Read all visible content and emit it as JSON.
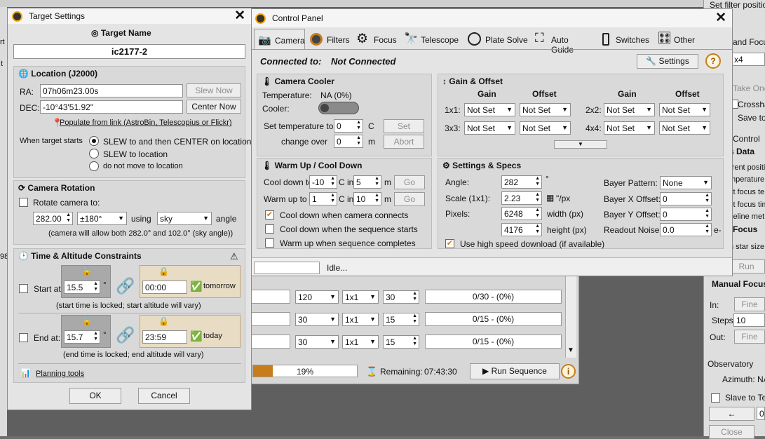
{
  "target_settings": {
    "title": "Target Settings",
    "target_name_label": "Target Name",
    "target_name": "ic2177-2",
    "location_label": "Location (J2000)",
    "ra_label": "RA:",
    "ra_value": "07h06m23.00s",
    "dec_label": "DEC:",
    "dec_value": "-10°43'51.92\"",
    "slew_now": "Slew Now",
    "center_now": "Center Now",
    "populate_link": "Populate from link (AstroBin, Telescopius or Flickr)",
    "when_target_starts": "When target starts",
    "radio_slew_center": "SLEW to and then CENTER on location",
    "radio_slew": "SLEW to location",
    "radio_no_move": "do not move to location",
    "camera_rotation_label": "Camera Rotation",
    "rotate_camera_label": "Rotate camera to:",
    "rotation_value": "282.00",
    "rotation_tolerance": "±180°",
    "using_label": "using",
    "rotation_ref": "sky",
    "angle_label": "angle",
    "rotation_note": "(camera will allow both 282.0° and 102.0° (sky angle))",
    "time_alt_label": "Time & Altitude Constraints",
    "start_at_label": "Start at:",
    "start_alt": "15.5",
    "start_time": "00:00",
    "start_day": "tomorrow",
    "start_note": "(start time is locked; start altitude will vary)",
    "end_at_label": "End at:",
    "end_alt": "15.7",
    "end_time": "23:59",
    "end_day": "today",
    "end_note": "(end time is locked; end altitude will vary)",
    "planning_tools": "Planning tools",
    "ok": "OK",
    "cancel": "Cancel"
  },
  "control_panel": {
    "title": "Control Panel",
    "tabs": [
      "Camera",
      "Filters",
      "Focus",
      "Telescope",
      "Plate Solve",
      "Auto Guide",
      "Switches",
      "Other"
    ],
    "connected_label": "Connected to:",
    "connected_value": "Not Connected",
    "settings_button": "Settings",
    "camera_cooler": {
      "title": "Camera Cooler",
      "temperature_label": "Temperature:",
      "temperature_value": "NA (0%)",
      "cooler_label": "Cooler:",
      "set_temp_label": "Set temperature to",
      "set_temp_value": "0",
      "set_temp_unit": "C",
      "set_button": "Set",
      "change_over_label": "change over",
      "change_over_value": "0",
      "change_over_unit": "m",
      "abort_button": "Abort"
    },
    "gain_offset": {
      "title": "Gain & Offset",
      "headers": [
        "Gain",
        "Offset",
        "Gain",
        "Offset"
      ],
      "bins": [
        "1x1:",
        "3x3:",
        "2x2:",
        "4x4:"
      ],
      "not_set": "Not Set"
    },
    "warm_up": {
      "title": "Warm Up / Cool Down",
      "cool_down_label": "Cool down to",
      "cool_down_value": "-10",
      "cool_in_label": "C in",
      "cool_in_value": "5",
      "cool_unit": "m",
      "go1": "Go",
      "warm_up_label": "Warm up to",
      "warm_up_value": "1",
      "warm_in_label": "C in",
      "warm_in_value": "10",
      "warm_unit": "m",
      "go2": "Go",
      "chk1": "Cool down when camera connects",
      "chk2": "Cool down when the sequence starts",
      "chk3": "Warm up when sequence completes"
    },
    "specs": {
      "title": "Settings & Specs",
      "angle_label": "Angle:",
      "angle_value": "282",
      "angle_unit": "°",
      "scale_label": "Scale (1x1):",
      "scale_value": "2.23",
      "scale_unit": "\"/px",
      "pixels_label": "Pixels:",
      "width_value": "6248",
      "width_unit": "width (px)",
      "height_value": "4176",
      "height_unit": "height (px)",
      "bayer_pattern_label": "Bayer Pattern:",
      "bayer_pattern_value": "None",
      "bayer_x_label": "Bayer X Offset:",
      "bayer_x_value": "0",
      "bayer_y_label": "Bayer Y Offset:",
      "bayer_y_value": "0",
      "readout_label": "Readout Noise:",
      "readout_value": "0.0",
      "readout_unit": "e-",
      "high_speed": "Use high speed download (if available)"
    },
    "status": "Idle..."
  },
  "sequence": {
    "rows": [
      {
        "exp": "120",
        "bin": "1x1",
        "count": "30",
        "progress": "0/30 - (0%)"
      },
      {
        "exp": "30",
        "bin": "1x1",
        "count": "15",
        "progress": "0/15 - (0%)"
      },
      {
        "exp": "30",
        "bin": "1x1",
        "count": "15",
        "progress": "0/15 - (0%)"
      }
    ],
    "progress_percent": "19%",
    "progress_fraction": 0.19,
    "remaining_label": "Remaining:",
    "remaining_value": "07:43:30",
    "run_sequence": "Run Sequence"
  },
  "right_panel": {
    "set_filter": "Set filter position",
    "and_focus": "and Focus",
    "x4": "x4",
    "take_one": "Take One",
    "crosshair": "Crossha",
    "save_to": "Save to",
    "control": "Control",
    "s_data": "s Data",
    "lines": [
      "rrent positi",
      "mperature",
      "st focus te",
      "st focus tim",
      "seline met"
    ],
    "focus": "Focus",
    "star_size": "n star size",
    "run": "Run",
    "manual_focus": "Manual Focus",
    "in_label": "In:",
    "fine1": "Fine",
    "steps_label": "Steps:",
    "steps_value": "10",
    "out_label": "Out:",
    "fine2": "Fine",
    "observatory": "Observatory",
    "azimuth": "Azimuth:",
    "az_value": "NA",
    "slave": "Slave to Te",
    "coord": "0.",
    "close": "Close"
  },
  "left_strip": [
    "rt",
    "t",
    "98"
  ]
}
